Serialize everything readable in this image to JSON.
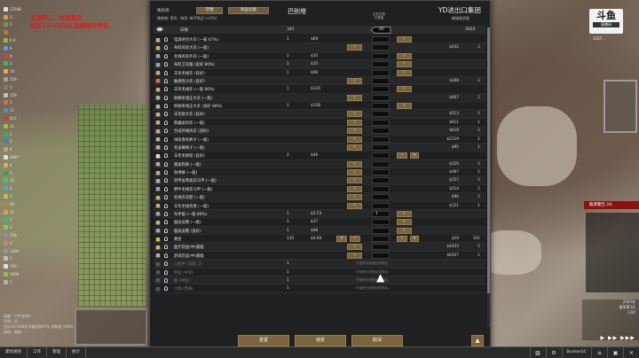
{
  "left_resources": [
    {
      "color": "#e0e0e0",
      "value": "13548"
    },
    {
      "color": "#c8a040",
      "value": "3"
    },
    {
      "color": "#6a9a50",
      "value": "1"
    },
    {
      "color": "#b07a40",
      "value": ""
    },
    {
      "color": "#8abb30",
      "value": "0.4"
    },
    {
      "color": "#4aa0e0",
      "value": "6"
    },
    {
      "color": "#d04040",
      "value": "4"
    },
    {
      "color": "#30c050",
      "value": "2"
    },
    {
      "color": "#e0b040",
      "value": "10"
    },
    {
      "color": "#9aa0a8",
      "value": "129"
    },
    {
      "color": "#8a7a60",
      "value": "1"
    },
    {
      "color": "#c0c0c0",
      "value": "159"
    },
    {
      "color": "#d07040",
      "value": "5"
    },
    {
      "color": "#40a0a0",
      "value": "17"
    },
    {
      "color": "#c04040",
      "value": "412"
    },
    {
      "color": "#a0c040",
      "value": "11"
    },
    {
      "color": "#30b060",
      "value": "2"
    },
    {
      "color": "#4080c0",
      "value": "1"
    },
    {
      "color": "#c0a080",
      "value": "4"
    },
    {
      "color": "#e0e0e0",
      "value": "4987"
    },
    {
      "color": "#d0b060",
      "value": "4"
    },
    {
      "color": "#3aa050",
      "value": "1"
    },
    {
      "color": "#50c070",
      "value": "15"
    },
    {
      "color": "#60a0d0",
      "value": "2"
    },
    {
      "color": "#c0c040",
      "value": "1"
    },
    {
      "color": "#b08050",
      "value": "50"
    },
    {
      "color": "#e0a040",
      "value": "31"
    },
    {
      "color": "#40b0a0",
      "value": "1"
    },
    {
      "color": "#70d060",
      "value": "3"
    },
    {
      "color": "#a080c0",
      "value": "159"
    },
    {
      "color": "#d08080",
      "value": "3"
    },
    {
      "color": "#80a0a0",
      "value": "1304"
    },
    {
      "color": "#c0c0c0",
      "value": "1"
    },
    {
      "color": "#e0e0e0",
      "value": "156"
    },
    {
      "color": "#90c050",
      "value": "1000"
    },
    {
      "color": "#b0b0b0",
      "value": "7"
    }
  ],
  "overlay_red": [
    "主播等工，本局最佳",
    "缘生13-15行动 首播每月特级"
  ],
  "bottom_left_info": [
    "温度：已生长0%",
    "环境：好",
    "总计15-16/4到 6级成熟67% 成熟度 140%",
    "结构：瑕疵"
  ],
  "bottom_bar": {
    "tabs": [
      "建筑规划",
      "工作",
      "管理",
      "统计"
    ],
    "right_label": "BunkerGC",
    "right_icons": [
      "▨",
      "⚙",
      "≡",
      "▣",
      "✕"
    ]
  },
  "logo": {
    "big": "斗鱼",
    "small": "直播间",
    "room_id": "1257..."
  },
  "alert": "敌袭警告 (4)",
  "time_info": [
    "2045年",
    "夏季第3天",
    "12时"
  ],
  "speed": "▶ ▶▶ ▶▶▶",
  "dialog": {
    "left_header_label": "殖民地",
    "left_buttons": [
      "货物",
      "商品分类"
    ],
    "left_title": "巴别塔",
    "right_title": "YD进出口集团",
    "sub_left": "建筑物: 黑色 · 物资: 新手购买 (+0%)",
    "sub_right": "敏捷度质量",
    "mid_header": [
      "正在交易",
      "交易量"
    ],
    "silver": {
      "name": "白银",
      "left": "345",
      "qty": "90",
      "right": "3920"
    },
    "rows": [
      {
        "icon": "#c9b27a",
        "name": "电源背包大衣 (一般 67%)",
        "lcount": "1",
        "lprice": "$69",
        "left_btn": false,
        "qty": "",
        "right_btn": true,
        "rprice": "",
        "rcount": ""
      },
      {
        "icon": "#c9b27a",
        "name": "布料风衣大衣 (一般)",
        "lcount": "",
        "lprice": "",
        "left_btn": true,
        "qty": "",
        "right_btn": false,
        "rprice": "$242",
        "rcount": "1"
      },
      {
        "icon": "#9aa6b2",
        "name": "毛线风衣外衣 (一般)",
        "lcount": "1",
        "lprice": "$35",
        "left_btn": false,
        "qty": "",
        "right_btn": true,
        "rprice": "",
        "rcount": ""
      },
      {
        "icon": "#9aa6b2",
        "name": "布料卫衣服 (良好 80%)",
        "lcount": "1",
        "lprice": "$35",
        "left_btn": false,
        "qty": "",
        "right_btn": true,
        "rprice": "",
        "rcount": ""
      },
      {
        "icon": "#c9b27a",
        "name": "羊毛毛绒衣 (良好)",
        "lcount": "1",
        "lprice": "$96",
        "left_btn": false,
        "qty": "",
        "right_btn": true,
        "rprice": "",
        "rcount": ""
      },
      {
        "icon": "#d86b6b",
        "name": "敏感性冷衣 (良好)",
        "lcount": "",
        "lprice": "",
        "left_btn": true,
        "qty": "",
        "right_btn": false,
        "rprice": "$308",
        "rcount": "1"
      },
      {
        "icon": "#c9b27a",
        "name": "羊毛毛绒衣 (一般 86%)",
        "lcount": "1",
        "lprice": "$124",
        "left_btn": false,
        "qty": "",
        "right_btn": true,
        "rprice": "",
        "rcount": ""
      },
      {
        "icon": "#b0b0b0",
        "name": "棕榈毛线正大衣 (一般)",
        "lcount": "",
        "lprice": "",
        "left_btn": true,
        "qty": "",
        "right_btn": false,
        "rprice": "$407",
        "rcount": "1"
      },
      {
        "icon": "#b0b0b0",
        "name": "棕榈毛线正大衣 (良好 86%)",
        "lcount": "1",
        "lprice": "$158",
        "left_btn": false,
        "qty": "",
        "right_btn": true,
        "rprice": "",
        "rcount": ""
      },
      {
        "icon": "#c9b27a",
        "name": "羊毛防大衣 (良好)",
        "lcount": "",
        "lprice": "",
        "left_btn": true,
        "qty": "",
        "right_btn": false,
        "rprice": "$513",
        "rcount": "1"
      },
      {
        "icon": "#c9b27a",
        "name": "新疆皮风衣 (一般)",
        "lcount": "",
        "lprice": "",
        "left_btn": true,
        "qty": "",
        "right_btn": false,
        "rprice": "$611",
        "rcount": "1"
      },
      {
        "icon": "#c9b27a",
        "name": "合成纤维风衣 (良好)",
        "lcount": "",
        "lprice": "",
        "left_btn": true,
        "qty": "",
        "right_btn": false,
        "rprice": "$619",
        "rcount": "1"
      },
      {
        "icon": "#b0b0b0",
        "name": "绿皮香毛裤子 (一般)",
        "lcount": "",
        "lprice": "",
        "left_btn": true,
        "qty": "",
        "right_btn": false,
        "rprice": "$2119",
        "rcount": "1"
      },
      {
        "icon": "#c9b27a",
        "name": "毛皮裤裤子 (一般)",
        "lcount": "",
        "lprice": "",
        "left_btn": true,
        "qty": "",
        "right_btn": false,
        "rprice": "$95",
        "rcount": "1"
      },
      {
        "icon": "#e0e0e0",
        "name": "羊毛毛裤壁 (良好)",
        "lcount": "2",
        "lprice": "$46",
        "left_btn": false,
        "qty": "",
        "right_btn": true,
        "right_btn2": true,
        "rprice": "",
        "rcount": ""
      },
      {
        "icon": "#b0b0b0",
        "name": "富家狗裤 (一般)",
        "lcount": "",
        "lprice": "",
        "left_btn": true,
        "qty": "",
        "right_btn": false,
        "rprice": "$320",
        "rcount": "1"
      },
      {
        "icon": "#c9b27a",
        "name": "防弹裤 (一般)",
        "lcount": "",
        "lprice": "",
        "left_btn": true,
        "qty": "",
        "right_btn": false,
        "rprice": "$387",
        "rcount": "1"
      },
      {
        "icon": "#b0b0b0",
        "name": "轻甲皮革类衣马甲 (一般)",
        "lcount": "",
        "lprice": "",
        "left_btn": true,
        "qty": "",
        "right_btn": false,
        "rprice": "$157",
        "rcount": "1"
      },
      {
        "icon": "#9aa6b2",
        "name": "野牛毛线衣马甲 (一般)",
        "lcount": "",
        "lprice": "",
        "left_btn": true,
        "qty": "",
        "right_btn": false,
        "rprice": "$214",
        "rcount": "1"
      },
      {
        "icon": "#c9b27a",
        "name": "毛线衣衣壁 (一般)",
        "lcount": "",
        "lprice": "",
        "left_btn": true,
        "qty": "",
        "right_btn": false,
        "rprice": "$96",
        "rcount": "1"
      },
      {
        "icon": "#c9b27a",
        "name": "羊毛毛绒衣壁 (一般)",
        "lcount": "",
        "lprice": "",
        "left_btn": true,
        "qty": "",
        "right_btn": false,
        "rprice": "$121",
        "rcount": "1"
      },
      {
        "icon": "#9aa6b2",
        "name": "布手套 (一般 80%)",
        "lcount": "1",
        "lprice": "$2.53",
        "left_btn": false,
        "qty": "1",
        "right_btn": true,
        "rprice": "",
        "rcount": ""
      },
      {
        "icon": "#c9b27a",
        "name": "鹿皮皮靴 (一般)",
        "lcount": "1",
        "lprice": "$37",
        "left_btn": false,
        "qty": "",
        "right_btn": true,
        "rprice": "",
        "rcount": ""
      },
      {
        "icon": "#9aa6b2",
        "name": "鹿皮皮靴 (良好)",
        "lcount": "1",
        "lprice": "$46",
        "left_btn": false,
        "qty": "",
        "right_btn": true,
        "rprice": "",
        "rcount": ""
      },
      {
        "icon": "#e3b43a",
        "name": "黄金",
        "lcount": "135",
        "lprice": "$4.94",
        "left_btn": true,
        "left_btn2": true,
        "qty": "",
        "right_btn": true,
        "right_btn2": true,
        "rprice": "$19",
        "rcount": "101"
      },
      {
        "icon": "#c9b27a",
        "name": "医疗药品(中)基础",
        "lcount": "",
        "lprice": "",
        "left_btn": true,
        "qty": "",
        "right_btn": false,
        "rprice": "$4433",
        "rcount": "1"
      },
      {
        "icon": "#b0b0b0",
        "name": "舒适药品(中)基础",
        "lcount": "",
        "lprice": "",
        "left_btn": true,
        "qty": "",
        "right_btn": false,
        "rprice": "$6207",
        "rcount": "1"
      },
      {
        "icon": "#555",
        "name": "心脏中 (高级, 2)",
        "lcount": "1",
        "lprice": "",
        "dim": true,
        "note": "不接受可接受此类物品。",
        "rprice": "",
        "rcount": ""
      },
      {
        "icon": "#555",
        "name": "肝脏 (中等)",
        "lcount": "1",
        "lprice": "",
        "dim": true,
        "note": "不接受可接受此类物品。",
        "rprice": "",
        "rcount": ""
      },
      {
        "icon": "#555",
        "name": "肺 (中等)",
        "lcount": "1",
        "lprice": "",
        "dim": true,
        "note": "不接受可接受此类物品。",
        "rprice": "",
        "rcount": ""
      },
      {
        "icon": "#555",
        "name": "小酒 (普通)",
        "lcount": "1",
        "lprice": "",
        "dim": true,
        "note": "不接受可接受此类物品。",
        "rprice": "",
        "rcount": ""
      }
    ],
    "footer": [
      "重置",
      "接受",
      "取消"
    ],
    "footer_icon": "▲"
  },
  "colors": {
    "accent_button": "#7a6440",
    "panel": "#1f2021",
    "alert_red": "#8b1111",
    "overlay_red": "#e31b1b"
  }
}
